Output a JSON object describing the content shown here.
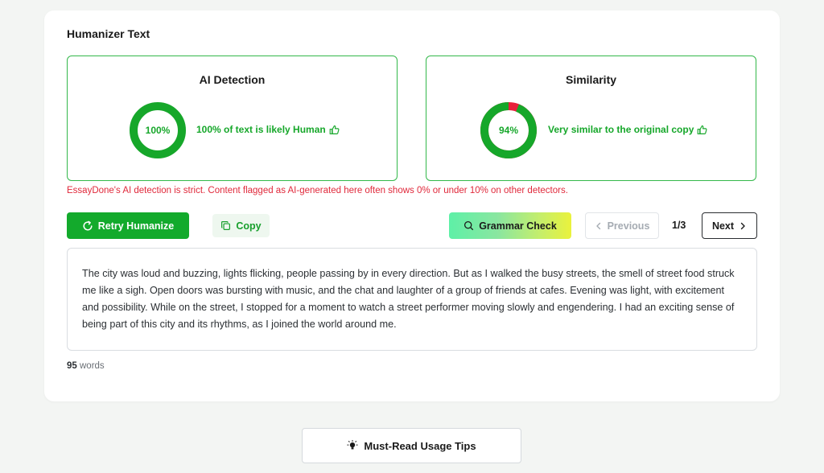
{
  "section_title": "Humanizer Text",
  "ai_detection": {
    "title": "AI Detection",
    "percent_label": "100%",
    "human_fraction": 1.0,
    "description": "100% of text is likely Human",
    "ring_color": "#16a72a"
  },
  "similarity": {
    "title": "Similarity",
    "percent_label": "94%",
    "similar_fraction": 0.94,
    "description": "Very similar to the original copy",
    "ring_color": "#16a72a",
    "remainder_color": "#e8203a"
  },
  "warning_text": "EssayDone's AI detection is strict. Content flagged as AI-generated here often shows 0% or under 10% on other detectors.",
  "toolbar": {
    "retry_label": "Retry Humanize",
    "copy_label": "Copy",
    "grammar_label": "Grammar Check",
    "previous_label": "Previous",
    "page_indicator": "1/3",
    "next_label": "Next"
  },
  "output_text": "The city was loud and buzzing, lights flicking, people passing by in every direction. But as I walked the busy streets, the smell of street food struck me like a sigh. Open doors was bursting with music, and the chat and laughter of a group of friends at cafes. Evening was light, with excitement and possibility. While on the street, I stopped for a moment to watch a street performer moving slowly and engendering. I had an exciting sense of being part of this city and its rhythms, as I joined the world around me.",
  "word_count": {
    "count": "95",
    "unit": "words"
  },
  "tips_label": "Must-Read Usage Tips",
  "colors": {
    "accent_green": "#13aa2c",
    "warning_red": "#e0293b"
  }
}
